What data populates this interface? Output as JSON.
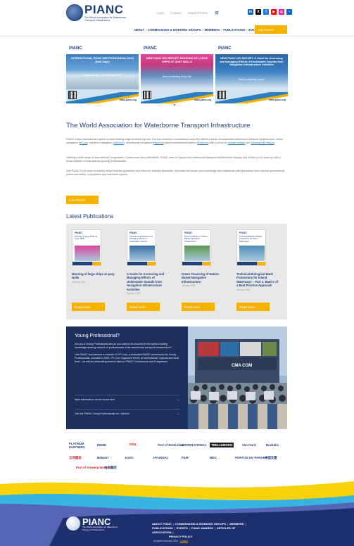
{
  "header": {
    "logo_word": "PIANC",
    "logo_sub": "The World Association for Waterborne Transport Infrastructure",
    "top_links": [
      "Login",
      "Contact",
      "Search PIANC"
    ],
    "nav": [
      "ABOUT",
      "COMMISSIONS & WORKING GROUPS",
      "MEMBERS",
      "PUBLICATIONS",
      "EVENTS",
      "AWARDS"
    ],
    "join_label": "Join PIANC",
    "socials": [
      {
        "name": "linkedin-icon",
        "glyph": "in",
        "color": "#0a66c2"
      },
      {
        "name": "x-icon",
        "glyph": "X",
        "color": "#111111"
      },
      {
        "name": "facebook-icon",
        "glyph": "f",
        "color": "#1877f2"
      },
      {
        "name": "youtube-icon",
        "glyph": "▶",
        "color": "#ff0000"
      },
      {
        "name": "instagram-icon",
        "glyph": "◎",
        "color": "#d6249f"
      },
      {
        "name": "flickr-icon",
        "glyph": "•",
        "color": "#0063dc"
      }
    ]
  },
  "carousel": {
    "slides": [
      {
        "logo": "PIANC",
        "title": "INTERNATIONAL PIANC MEDITERRANEAN DAYS (Med Days)",
        "sub": "Tanger, Morocco – 29-30 October 2025",
        "url": "www.pianc.org"
      },
      {
        "logo": "PIANC",
        "title": "NEW PIANC WG REPORT: MOORING OF LARGE SHIPS AT QUAY WALLS",
        "sub": "MarCom Working Group 186",
        "url": "www.pianc.org"
      },
      {
        "logo": "PIANC",
        "title": "NEW PIANC WG REPORT: A Guide for Assessing and Managing Effects of Underwater Sounds from Navigation Infrastructure Activities",
        "sub": "EnviCom Working Group 2",
        "url": "www.pianc.org"
      }
    ]
  },
  "intro": {
    "title": "The World Association for Waterborne Transport Infrastructure",
    "p1_a": "PIANC unites international experts to write leading-edge technical reports. Our four technical Commissions cover the different areas of sustainable waterborne transport infrastructure: inland navigation (",
    "p1_l1": "InCom",
    "p1_b": "), maritime navigation (",
    "p1_l2": "MarCom",
    "p1_c": "), recreational navigation (",
    "p1_l3": "RecCom",
    "p1_d": ") and environmental matters (",
    "p1_l4": "EnviCom",
    "p1_e": ") with a focus on ",
    "p1_l5": "climate change",
    "p1_f": " and ",
    "p1_l6": "Working with Nature",
    "p1_g": ".",
    "p2": "Offering a wide range of International Congresses, Conferences and publications, PIANC aims to improve the waterborne transport infrastructure industry and invites you to team up with a broad network of international (young) professionals.",
    "p3": "Join PIANC if you want to actively shape industry guidelines and influence industry standards. Maximise and share your knowledge and collaborate with specialists from national governments, public authorities, corporations and individual experts.",
    "join_label": "Join PIANC"
  },
  "publications": {
    "heading": "Latest Publications",
    "items": [
      {
        "title": "Mooring of large ships at quay walls",
        "date": "January 2025",
        "button": "Read more",
        "cover_title": "Mooring of Large Ships at Quay Walls",
        "cover_color": "#d9469b"
      },
      {
        "title": "A Guide for Assessing and Managing Effects of Underwater Sounds from Navigation Infrastructure Activities",
        "date": "January 2025",
        "button": "Read more",
        "cover_title": "A Guide for Assessing and Managing Effects of Underwater Sounds",
        "cover_color": "#3a6fa8"
      },
      {
        "title": "Green Financing of Nature-Based Navigation Infrastructure",
        "date": "January 2025",
        "button": "Read more",
        "cover_title": "Green Financing of Nature-Based Navigation Infrastructure",
        "cover_color": "#5a9a4c"
      },
      {
        "title": "Technical-Biological Bank Protections for Inland Waterways – Part 1: Basics of a Best Practice Approach",
        "date": "January 2025",
        "button": "Read more",
        "cover_title": "Technical-Biological Bank Protections for Inland Waterways",
        "cover_color": "#4c8fb8"
      }
    ]
  },
  "young": {
    "heading": "Young Professional?",
    "p1": "Are you a Young Professional and do you want to be involved in the world's leading knowledge-sharing network of professionals in the waterborne transport infrastructure?",
    "p2": "Join PIANC and become a member of YP-Com, a dedicated PIANC commission for Young Professionals, founded in 2006. YP-Com organises events at international, regional and local level – as well as networking events linked to PIANC Conferences and Congresses.",
    "link1": "More information can be found here",
    "link2": "Join the PIANC Young Professionals on LinkedIn"
  },
  "partners": {
    "label_line1": "PLATINUM",
    "label_line2": "PARTNERS",
    "logos": [
      {
        "name": "deme-logo",
        "text": "DEME",
        "color": "#1d3f7a"
      },
      {
        "name": "dsn-logo",
        "text": "DSN",
        "color": "#d62027"
      },
      {
        "name": "port-of-rotterdam-logo",
        "text": "Port of Rotterdam",
        "color": "#1d3f7a"
      },
      {
        "name": "international-logo",
        "text": "INTERNATIONAL",
        "color": "#1d3f7a"
      },
      {
        "name": "trelleborg-logo",
        "text": "TRELLEBORG",
        "color": "#ffffff"
      },
      {
        "name": "van-oord-logo",
        "text": "Van Oord",
        "color": "#1d3f7a"
      },
      {
        "name": "boskalis-logo",
        "text": "Boskalis",
        "color": "#1d3f7a"
      },
      {
        "name": "wuhan-logo",
        "text": "五洋建设",
        "color": "#d62027"
      },
      {
        "name": "bekaert-logo",
        "text": "Bekaert",
        "color": "#1d3f7a"
      },
      {
        "name": "hjsc-logo",
        "text": "HJSC",
        "color": "#1d3f7a"
      },
      {
        "name": "hyundai-logo",
        "text": "HYUNDAI",
        "color": "#1d3f7a"
      },
      {
        "name": "fm-logo",
        "text": "F&M",
        "color": "#1d3f7a"
      },
      {
        "name": "mdc-logo",
        "text": "MDC",
        "color": "#1d3f7a"
      },
      {
        "name": "portos-do-parana-logo",
        "text": "PORTOS DO PARANÁ",
        "color": "#1d3f7a"
      },
      {
        "name": "cccc-logo",
        "text": "中国交建",
        "color": "#1d3f7a"
      },
      {
        "name": "port-of-antwerp-logo",
        "text": "Port of Antwerp Bruges",
        "color": "#d62027"
      },
      {
        "name": "ccc-logo",
        "text": "中交集团",
        "color": "#1d3f7a"
      }
    ]
  },
  "footer": {
    "logo_word": "PIANC",
    "logo_sub": "The World Association for Waterborne Transport Infrastructure",
    "nav_line1": [
      "ABOUT PIANC",
      "COMMISSIONS & WORKING GROUPS",
      "MEMBERS"
    ],
    "nav_line2": [
      "PUBLICATIONS",
      "EVENTS",
      "PIANC AWARDS",
      "ARTICLES OF ASSOCIATION"
    ],
    "nav_line3": [
      "PRIVACY POLICY"
    ],
    "copyright_text": "All rights reserved 2025 · ",
    "copyright_link": "Contact"
  }
}
